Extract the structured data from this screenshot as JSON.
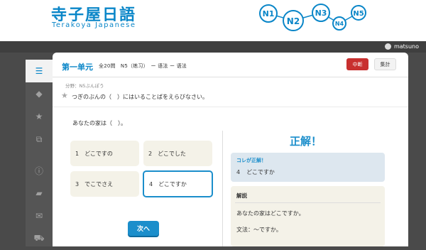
{
  "logo": {
    "jp": "寺子屋日語",
    "en": "Terakoya Japanese"
  },
  "levels": [
    "N1",
    "N2",
    "N3",
    "N4",
    "N5"
  ],
  "user": {
    "name": "matsuno"
  },
  "sidebar": {
    "items": [
      {
        "icon": "list-icon",
        "glyph": "☰"
      },
      {
        "icon": "tag-icon",
        "glyph": "◆"
      },
      {
        "icon": "star-icon",
        "glyph": "★"
      },
      {
        "icon": "chart-icon",
        "glyph": "⧉"
      },
      {
        "icon": "info-icon",
        "glyph": "ⓘ"
      },
      {
        "icon": "chat-icon",
        "glyph": "▰"
      },
      {
        "icon": "mail-icon",
        "glyph": "✉"
      },
      {
        "icon": "cart-icon",
        "glyph": "⛟"
      }
    ]
  },
  "quiz": {
    "title": "第一单元",
    "meta": "全20問　N5（练习）　ー 语法 ー 语法",
    "stop": "中断",
    "score": "集計",
    "category": "分野：N5ぶんぽう",
    "question": "つぎのぶんの（　）にはいることばをえらびなさい。",
    "sentence": "あなたの家は（　）。",
    "options": [
      {
        "num": "1",
        "text": "どこですの"
      },
      {
        "num": "2",
        "text": "どこでした"
      },
      {
        "num": "3",
        "text": "でこでさえ"
      },
      {
        "num": "4",
        "text": "どこですか"
      }
    ],
    "next": "次へ",
    "result": "正解！",
    "answer_label": "コレが正解！",
    "answer_num": "4",
    "answer_text": "どこですか",
    "explanation_label": "解説",
    "explanation_1": "あなたの家はどこですか。",
    "explanation_2": "文法：～ですか。"
  }
}
